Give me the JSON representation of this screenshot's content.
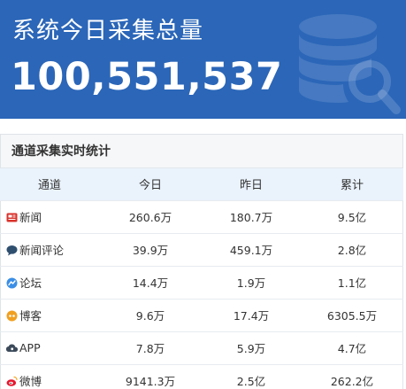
{
  "banner": {
    "title": "系统今日采集总量",
    "total": "100,551,537"
  },
  "panel": {
    "title": "通道采集实时统计",
    "columns": [
      "通道",
      "今日",
      "昨日",
      "累计"
    ],
    "rows": [
      {
        "icon": "news-icon",
        "channel": "新闻",
        "today": "260.6万",
        "yesterday": "180.7万",
        "total": "9.5亿"
      },
      {
        "icon": "comment-icon",
        "channel": "新闻评论",
        "today": "39.9万",
        "yesterday": "459.1万",
        "total": "2.8亿"
      },
      {
        "icon": "forum-icon",
        "channel": "论坛",
        "today": "14.4万",
        "yesterday": "1.9万",
        "total": "1.1亿"
      },
      {
        "icon": "blog-icon",
        "channel": "博客",
        "today": "9.6万",
        "yesterday": "17.4万",
        "total": "6305.5万"
      },
      {
        "icon": "app-cloud-icon",
        "channel": "APP",
        "today": "7.8万",
        "yesterday": "5.9万",
        "total": "4.7亿"
      },
      {
        "icon": "weibo-icon",
        "channel": "微博",
        "today": "9141.3万",
        "yesterday": "2.5亿",
        "total": "262.2亿"
      }
    ]
  },
  "colors": {
    "banner_bg": "#2b66b8",
    "header_row_bg": "#eaf3fc",
    "news_icon": "#d9322b",
    "comment_icon": "#2f4f6f",
    "forum_icon": "#3a8ee6",
    "blog_icon": "#f0a020",
    "app_icon": "#3c4a5a",
    "weibo_icon": "#e6162d"
  }
}
